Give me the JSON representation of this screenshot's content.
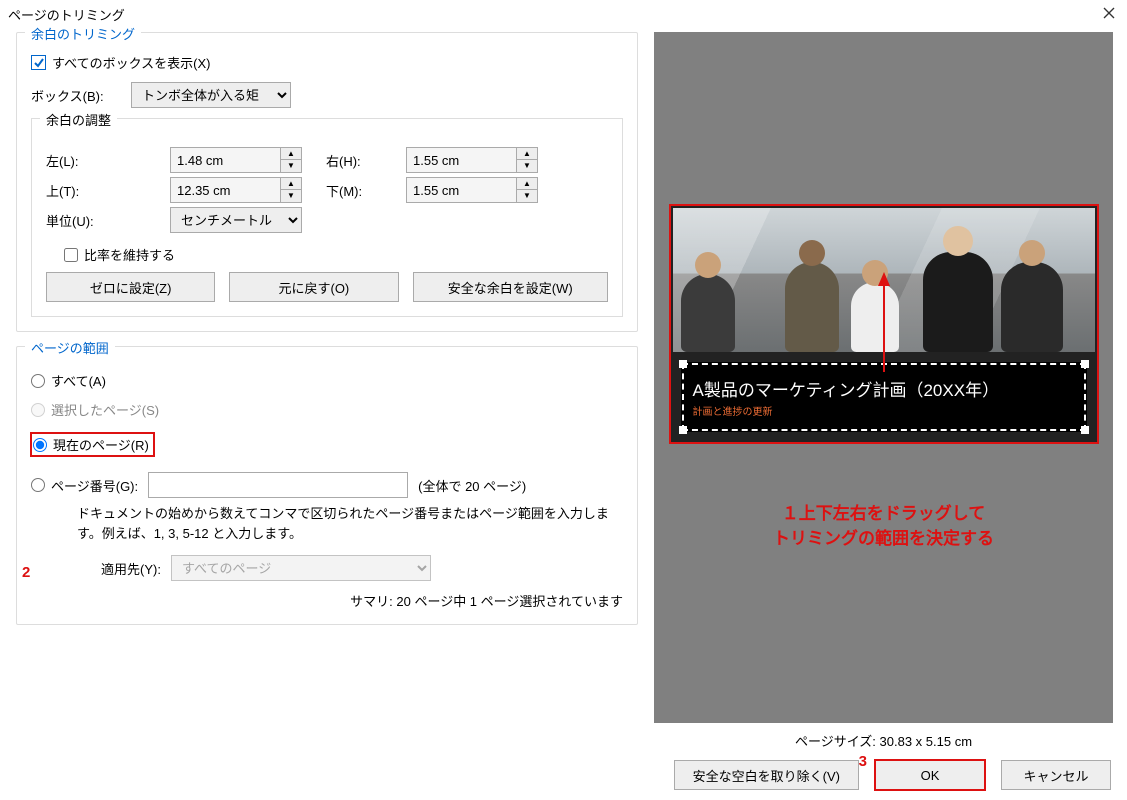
{
  "dialog_title": "ページのトリミング",
  "margin_trim": {
    "title": "余白のトリミング",
    "show_all_boxes": "すべてのボックスを表示(X)",
    "box_label": "ボックス(B):",
    "box_value": "トンボ全体が入る矩",
    "margin_adjust": {
      "title": "余白の調整",
      "left_label": "左(L):",
      "left_value": "1.48 cm",
      "right_label": "右(H):",
      "right_value": "1.55 cm",
      "top_label": "上(T):",
      "top_value": "12.35 cm",
      "bottom_label": "下(M):",
      "bottom_value": "1.55 cm",
      "unit_label": "単位(U):",
      "unit_value": "センチメートル",
      "keep_ratio": "比率を維持する",
      "btn_zero": "ゼロに設定(Z)",
      "btn_reset": "元に戻す(O)",
      "btn_safe": "安全な余白を設定(W)"
    }
  },
  "page_range": {
    "title": "ページの範囲",
    "all": "すべて(A)",
    "selected": "選択したページ(S)",
    "current": "現在のページ(R)",
    "pagenum_label": "ページ番号(G):",
    "pagenum_value": "",
    "pagenum_total": "(全体で 20 ページ)",
    "help": "ドキュメントの始めから数えてコンマで区切られたページ番号またはページ範囲を入力します。例えば、1, 3, 5-12 と入力します。",
    "apply_label": "適用先(Y):",
    "apply_value": "すべてのページ",
    "summary": "サマリ: 20 ページ中 1 ページ選択されています"
  },
  "preview": {
    "title_main": "A製品のマーケティング計画（20XX年）",
    "title_sub": "計画と進捗の更新",
    "page_size": "ページサイズ: 30.83 x 5.15 cm",
    "annotation_line1": "１上下左右をドラッグして",
    "annotation_line2": "トリミングの範囲を決定する"
  },
  "footer": {
    "remove_white": "安全な空白を取り除く(V)",
    "ok": "OK",
    "cancel": "キャンセル"
  },
  "markers": {
    "m2": "2",
    "m3": "3"
  }
}
